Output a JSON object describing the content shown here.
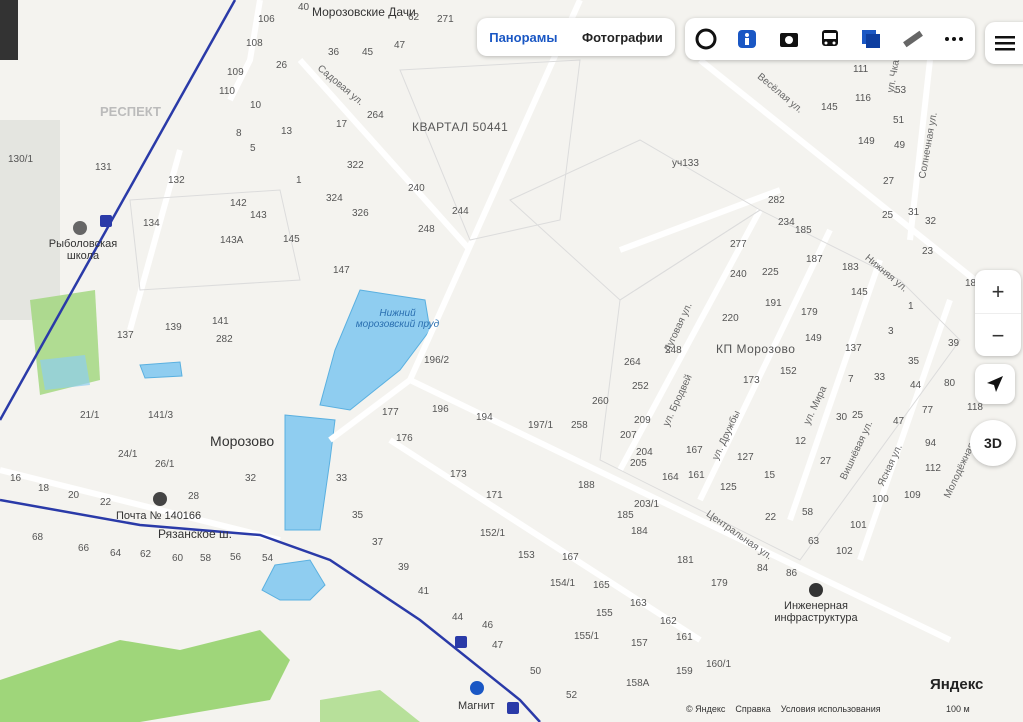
{
  "layers": {
    "panoramas": "Панорамы",
    "photos": "Фотографии"
  },
  "toolbar_icons": [
    "traffic-icon",
    "accessibility-icon",
    "camera-icon",
    "transport-icon",
    "layers-icon",
    "ruler-icon",
    "more-icon"
  ],
  "controls": {
    "zoom_in": "+",
    "zoom_out": "−",
    "view_3d": "3D"
  },
  "places": {
    "settlement_dachi": "Морозовские Дачи",
    "kvartal": "КВАРТАЛ 50441",
    "pond": "Нижний морозовский пруд",
    "village": "Морозово",
    "kp": "КП Морозово",
    "school": "Рыболовская школа",
    "post": "Почта № 140166",
    "magnit": "Магнит",
    "infra": "Инженерная инфраструктура",
    "plot": "уч133",
    "respect": "РЕСПЕКТ"
  },
  "streets": {
    "sadovaya": "Садовая ул.",
    "lugovaya": "Луговая ул.",
    "brodey": "ул. Бродвей",
    "druzhby": "ул. Дружбы",
    "mira": "ул. Мира",
    "vishnevaya": "Вишнёвая ул.",
    "yasnaya": "Ясная ул.",
    "nizhnyaya": "Нижняя ул.",
    "tsentralnaya": "Центральная ул.",
    "vesyolaya": "Весёлая ул.",
    "solnechnaya": "Солнечная ул.",
    "chkalova": "ул. Чкалова",
    "molodezhnaya": "Молодёжная",
    "ryazanskoe": "Рязанское ш."
  },
  "house_numbers": [
    "40",
    "106",
    "62",
    "271",
    "108",
    "36",
    "45",
    "47",
    "109",
    "26",
    "110",
    "10",
    "264",
    "17",
    "8",
    "13",
    "5",
    "1",
    "322",
    "240",
    "324",
    "326",
    "244",
    "248",
    "130/1",
    "131",
    "132",
    "134",
    "142",
    "143",
    "143А",
    "145",
    "147",
    "137",
    "139",
    "141",
    "282",
    "196/2",
    "177",
    "196",
    "194",
    "197/1",
    "258",
    "176",
    "21/1",
    "141/3",
    "24/1",
    "26/1",
    "16",
    "18",
    "20",
    "22",
    "28",
    "32",
    "33",
    "35",
    "37",
    "39",
    "41",
    "44",
    "46",
    "47",
    "50",
    "52",
    "68",
    "66",
    "64",
    "62",
    "60",
    "58",
    "56",
    "54",
    "173",
    "171",
    "152/1",
    "153",
    "167",
    "154/1",
    "165",
    "155",
    "155/1",
    "157",
    "163",
    "162",
    "161",
    "159",
    "160/1",
    "158А",
    "181",
    "179",
    "188",
    "185",
    "184",
    "203/1",
    "282",
    "234",
    "277",
    "185",
    "187",
    "183",
    "240",
    "225",
    "145",
    "191",
    "179",
    "149",
    "137",
    "220",
    "248",
    "264",
    "252",
    "173",
    "152",
    "260",
    "209",
    "207",
    "204",
    "205",
    "167",
    "161",
    "164",
    "127",
    "125",
    "15",
    "22",
    "58",
    "63",
    "102",
    "101",
    "86",
    "84",
    "111",
    "116",
    "145",
    "53",
    "51",
    "49",
    "149",
    "27",
    "25",
    "31",
    "32",
    "23",
    "18",
    "1",
    "3",
    "35",
    "39",
    "33",
    "7",
    "30",
    "47",
    "44",
    "80",
    "77",
    "94",
    "112",
    "109",
    "100",
    "118",
    "12",
    "27",
    "25"
  ],
  "footer": {
    "copyright": "© Яндекс",
    "help": "Справка",
    "terms": "Условия использования",
    "scale": "100 м",
    "logo": "Яндекс"
  },
  "colors": {
    "water": "#8fcdf0",
    "water_edge": "#5ab0e0",
    "park": "#9fd67a",
    "road_main": "#2a3aa8",
    "accent": "#1a57c4"
  }
}
